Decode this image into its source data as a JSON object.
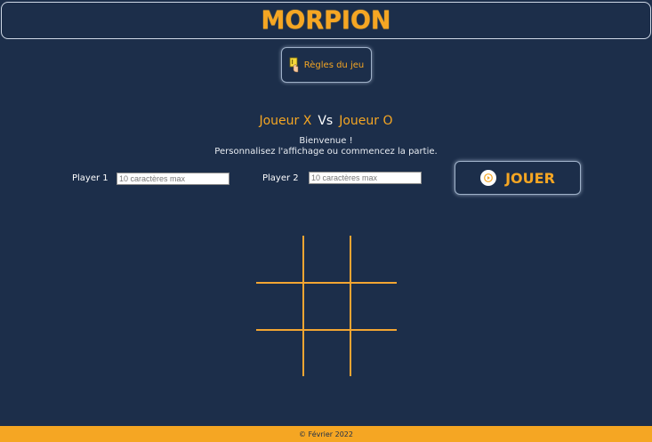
{
  "header": {
    "title": "MORPION"
  },
  "rules_button": {
    "label": "Règles du jeu",
    "icon": "rules-icon"
  },
  "players_title": {
    "player_x": "Joueur X",
    "vs": "Vs",
    "player_o": "Joueur O"
  },
  "welcome": {
    "line1": "Bienvenue !",
    "line2": "Personnalisez l'affichage ou commencez la partie."
  },
  "player1": {
    "label": "Player 1",
    "placeholder": "10 caractères max",
    "value": ""
  },
  "player2": {
    "label": "Player 2",
    "placeholder": "10 caractères max",
    "value": ""
  },
  "play_button": {
    "label": "JOUER",
    "icon": "play-icon"
  },
  "board": {
    "cells": [
      "",
      "",
      "",
      "",
      "",
      "",
      "",
      "",
      ""
    ]
  },
  "footer": {
    "text": "© Février 2022"
  },
  "colors": {
    "background": "#1c2e4a",
    "accent": "#f5a623",
    "text": "#ffffff"
  }
}
